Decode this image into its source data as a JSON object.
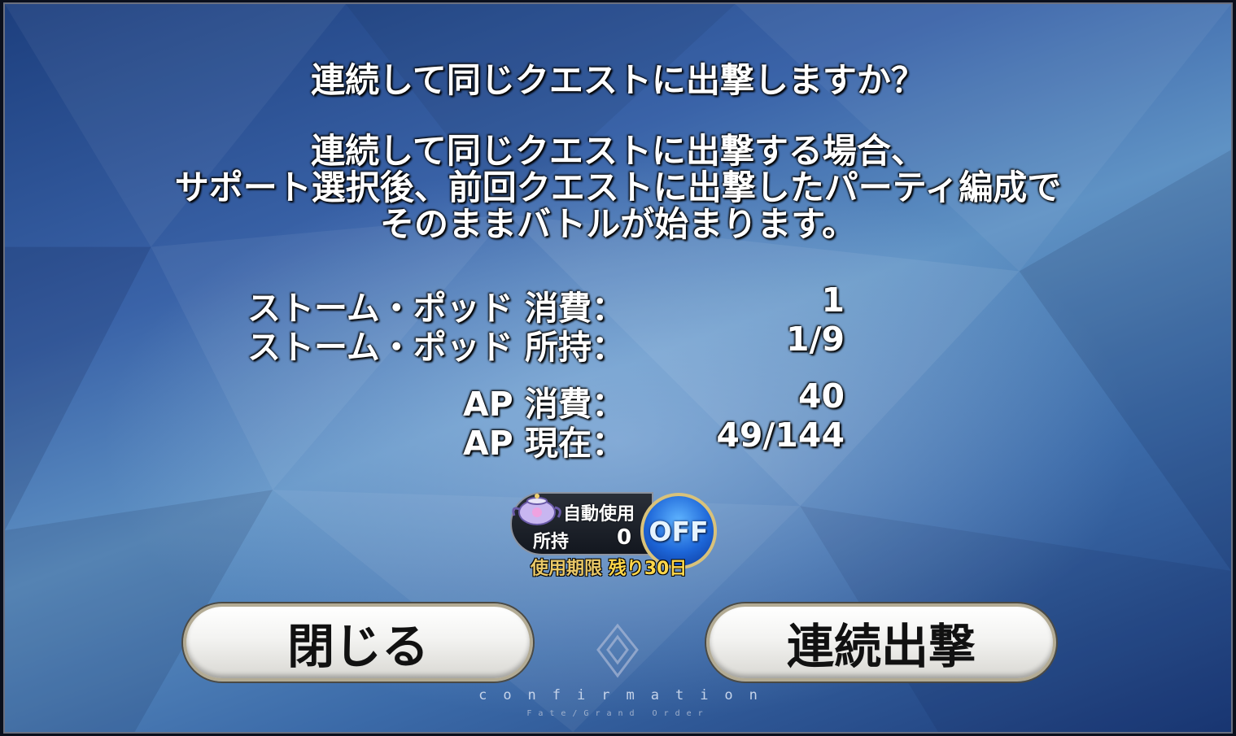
{
  "dialog": {
    "title": "連続して同じクエストに出撃しますか？",
    "description_lines": [
      "連続して同じクエストに出撃する場合、",
      "サポート選択後、前回クエストに出撃したパーティ編成で",
      "そのままバトルが始まります。"
    ]
  },
  "stats": [
    {
      "label": "ストーム・ポッド 消費：",
      "value": "1"
    },
    {
      "label": "ストーム・ポッド 所持：",
      "value": "1/9"
    },
    {
      "label": "AP 消費：",
      "value": "40"
    },
    {
      "label": "AP 現在：",
      "value": "49/144"
    }
  ],
  "auto_use": {
    "label": "自動使用",
    "hold_label": "所持",
    "hold_value": "0",
    "toggle": "OFF",
    "expiry_label": "使用期限",
    "expiry_remaining": "残り30日",
    "icon": "teapot-icon"
  },
  "buttons": {
    "close": "閉じる",
    "repeat": "連続出撃"
  },
  "footer": {
    "confirmation": "confirmation",
    "brand": "Fate/Grand Order"
  },
  "colors": {
    "toggle_blue": "#1d66d8",
    "gold": "#ffd74a"
  }
}
